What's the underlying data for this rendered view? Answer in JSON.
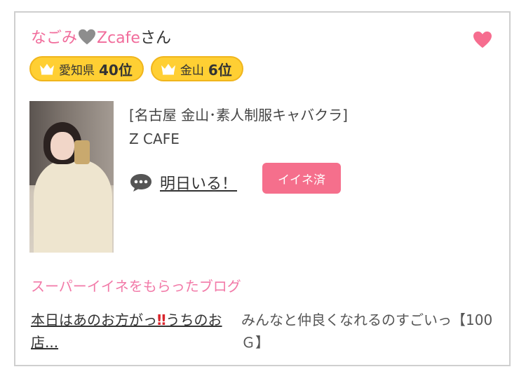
{
  "card": {
    "name_pink": "なごみ",
    "name_brand": "Zcafe",
    "name_suffix": "さん",
    "badges": [
      {
        "area": "愛知県",
        "rank": "40位"
      },
      {
        "area": "金山",
        "rank": "6位"
      }
    ],
    "shop_category": "[名古屋 金山･素人制服キャバクラ]",
    "shop_name": "Z CAFE",
    "status_text": "明日いる！",
    "iine_button": "イイネ済"
  },
  "blog": {
    "heading": "スーパーイイネをもらったブログ",
    "link_text_1": "本日はあのお方がっ",
    "link_emoji": "‼",
    "link_text_2": "うちのお店...",
    "excerpt": "みんなと仲良くなれるのすごいっ【100Ｇ】"
  },
  "colors": {
    "accent_pink": "#f16c9b",
    "button_pink": "#f56f8c",
    "badge_yellow": "#ffcf33"
  },
  "icons": [
    "gray-heart-icon",
    "heart-icon",
    "crown-icon",
    "speech-bubble-icon"
  ]
}
